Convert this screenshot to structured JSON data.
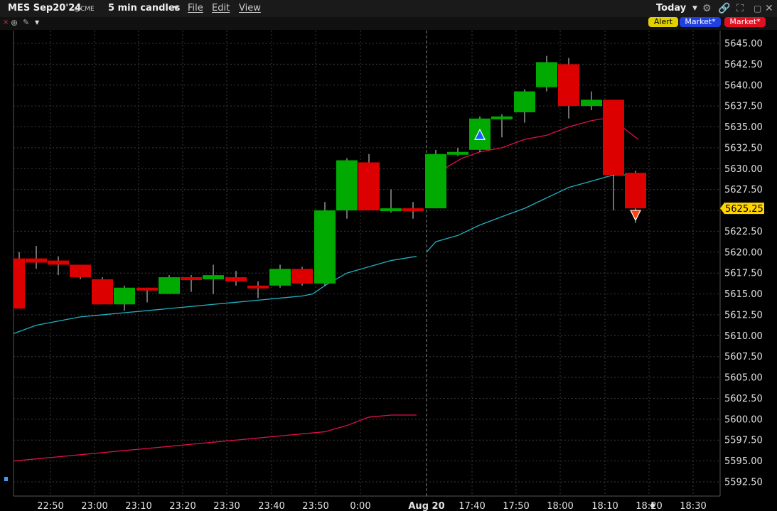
{
  "header": {
    "symbol": "MES Sep20'24",
    "exchange": "@CME",
    "interval": "5 min candles",
    "menu": [
      "File",
      "Edit",
      "View"
    ],
    "period": "Today",
    "buttons": {
      "alert": "Alert",
      "market1": "Market*",
      "market2": "Market*"
    }
  },
  "colors": {
    "up": "#00aa00",
    "down": "#dd0000",
    "ma_fast": "#e0104a",
    "ma_slow": "#20b0c0",
    "background": "#000000",
    "grid": "#3a3a3a"
  },
  "icons": [
    "close-icon",
    "crosshair-icon",
    "draw-tools-icon",
    "dropdown-icon",
    "settings-icon",
    "link-icon",
    "maximize-icon",
    "restore-icon",
    "close-window-icon"
  ],
  "chart_data": {
    "type": "candlestick",
    "ylim": [
      5591.0,
      5647.5
    ],
    "yticks": [
      5592.5,
      5595,
      5597.5,
      5600,
      5602.5,
      5605,
      5607.5,
      5610,
      5612.5,
      5615,
      5617.5,
      5620,
      5622.5,
      5625,
      5627.5,
      5630,
      5632.5,
      5635,
      5637.5,
      5640,
      5642.5,
      5645
    ],
    "ytick_labels": [
      "5592.50",
      "5595.00",
      "5597.50",
      "5600.00",
      "5602.50",
      "5605.00",
      "5607.50",
      "5610.00",
      "5612.50",
      "5615.00",
      "5617.50",
      "5620.00",
      "5622.50",
      "5625.00",
      "5627.50",
      "5630.00",
      "5632.50",
      "5635.00",
      "5637.50",
      "5640.00",
      "5642.50",
      "5645.00"
    ],
    "xtick_labels": [
      "22:50",
      "23:00",
      "23:10",
      "23:20",
      "23:30",
      "23:40",
      "23:50",
      "0:00",
      "Aug 20",
      "17:40",
      "17:50",
      "18:00",
      "18:10",
      "18:20",
      "18:30"
    ],
    "session_break_label": "Aug 20",
    "last_price": "5625.25",
    "candles": [
      {
        "o": 5619.25,
        "h": 5620.0,
        "l": 5613.25,
        "c": 5613.25
      },
      {
        "o": 5619.25,
        "h": 5620.75,
        "l": 5618.0,
        "c": 5618.75
      },
      {
        "o": 5619.0,
        "h": 5619.5,
        "l": 5617.25,
        "c": 5618.5
      },
      {
        "o": 5618.5,
        "h": 5618.5,
        "l": 5616.75,
        "c": 5617.0
      },
      {
        "o": 5616.75,
        "h": 5617.0,
        "l": 5613.75,
        "c": 5613.75
      },
      {
        "o": 5613.75,
        "h": 5616.0,
        "l": 5613.0,
        "c": 5615.75
      },
      {
        "o": 5615.75,
        "h": 5615.75,
        "l": 5614.0,
        "c": 5615.5
      },
      {
        "o": 5615.0,
        "h": 5617.25,
        "l": 5615.0,
        "c": 5617.0
      },
      {
        "o": 5617.0,
        "h": 5617.25,
        "l": 5615.25,
        "c": 5616.75
      },
      {
        "o": 5616.75,
        "h": 5618.5,
        "l": 5615.0,
        "c": 5617.25
      },
      {
        "o": 5617.0,
        "h": 5617.75,
        "l": 5616.0,
        "c": 5616.5
      },
      {
        "o": 5616.0,
        "h": 5616.5,
        "l": 5614.5,
        "c": 5615.75
      },
      {
        "o": 5616.0,
        "h": 5618.5,
        "l": 5615.75,
        "c": 5618.0
      },
      {
        "o": 5618.0,
        "h": 5618.25,
        "l": 5616.0,
        "c": 5616.25
      },
      {
        "o": 5616.25,
        "h": 5626.0,
        "l": 5616.0,
        "c": 5625.0
      },
      {
        "o": 5625.0,
        "h": 5631.25,
        "l": 5624.0,
        "c": 5631.0
      },
      {
        "o": 5630.75,
        "h": 5631.75,
        "l": 5625.0,
        "c": 5625.0
      },
      {
        "o": 5625.0,
        "h": 5627.5,
        "l": 5624.75,
        "c": 5625.25
      },
      {
        "o": 5625.25,
        "h": 5626.0,
        "l": 5624.0,
        "c": 5625.0
      },
      {
        "o": 5625.25,
        "h": 5632.25,
        "l": 5625.25,
        "c": 5631.75
      },
      {
        "o": 5631.75,
        "h": 5632.5,
        "l": 5631.5,
        "c": 5632.0
      },
      {
        "o": 5632.25,
        "h": 5636.25,
        "l": 5632.0,
        "c": 5636.0
      },
      {
        "o": 5636.0,
        "h": 5636.5,
        "l": 5633.75,
        "c": 5636.25
      },
      {
        "o": 5636.75,
        "h": 5639.5,
        "l": 5635.5,
        "c": 5639.25
      },
      {
        "o": 5639.75,
        "h": 5643.5,
        "l": 5639.25,
        "c": 5642.75
      },
      {
        "o": 5642.5,
        "h": 5643.25,
        "l": 5636.0,
        "c": 5637.5
      },
      {
        "o": 5637.5,
        "h": 5639.25,
        "l": 5637.0,
        "c": 5638.25
      },
      {
        "o": 5638.25,
        "h": 5638.25,
        "l": 5625.0,
        "c": 5629.25
      },
      {
        "o": 5629.5,
        "h": 5629.75,
        "l": 5623.5,
        "c": 5625.25
      }
    ],
    "series": [
      {
        "values_pre": [
          5610.25,
          5611.25,
          5611.75,
          5612.25,
          5612.5,
          5612.75,
          5613.0,
          5613.25,
          5613.5,
          5613.75,
          5614.0,
          5614.25,
          5614.5,
          5614.75,
          5615.0,
          5616.0,
          5617.5,
          5618.25,
          5619.0,
          5619.5
        ],
        "values_post": [
          5620.0,
          5621.25,
          5622.0,
          5623.25,
          5624.25,
          5625.25,
          5626.5,
          5627.75,
          5628.5,
          5629.25,
          5629.25,
          5628.75
        ]
      },
      {
        "values_pre": [
          5595.0,
          5595.25,
          5595.5,
          5595.75,
          5596.0,
          5596.25,
          5596.5,
          5596.75,
          5597.0,
          5597.25,
          5597.5,
          5597.75,
          5598.0,
          5598.25,
          5598.5,
          5599.25,
          5600.25,
          5600.5,
          5600.5
        ],
        "values_post": [
          5629.25,
          5630.25,
          5631.25,
          5632.0,
          5632.5,
          5633.5,
          5634.0,
          5635.0,
          5635.75,
          5636.0,
          5635.0,
          5633.5
        ]
      }
    ],
    "signals": [
      {
        "candle_index": 21,
        "type": "buy",
        "price": 5634.0
      },
      {
        "candle_index": 28,
        "type": "sell",
        "price": 5624.5
      }
    ]
  }
}
